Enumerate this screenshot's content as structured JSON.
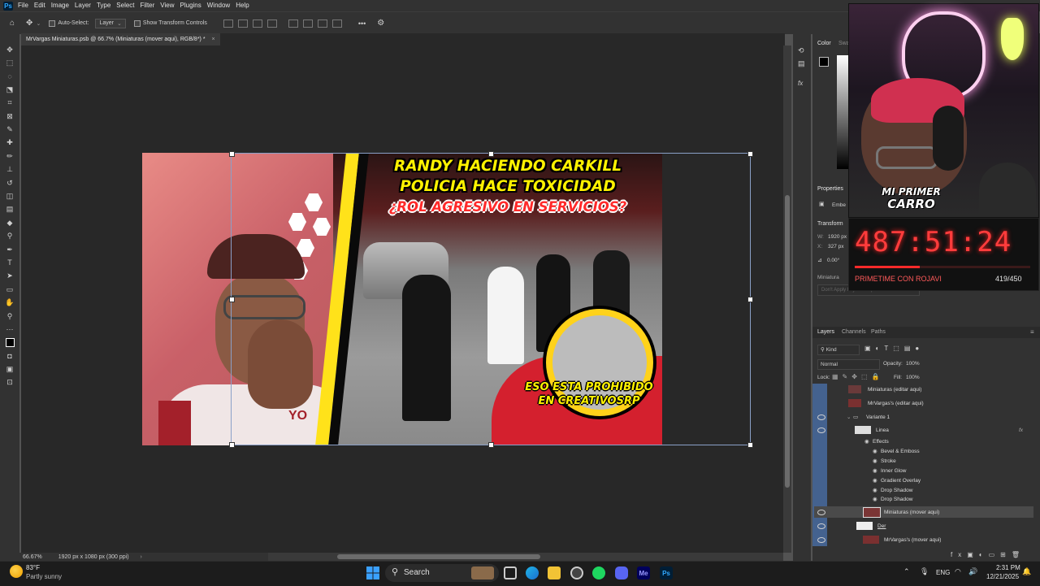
{
  "menubar": {
    "logo": "Ps",
    "items": [
      "File",
      "Edit",
      "Image",
      "Layer",
      "Type",
      "Select",
      "Filter",
      "View",
      "Plugins",
      "Window",
      "Help"
    ]
  },
  "options": {
    "auto_select_label": "Auto-Select:",
    "auto_select_value": "Layer",
    "show_transform_label": "Show Transform Controls",
    "more": "•••"
  },
  "document": {
    "tab_title": "MrVargas Miniaturas.psb @ 66.7% (Miniaturas (mover aqui), RGB/8*) *",
    "zoom": "66.67%",
    "size_info": "1920 px x 1080 px (300 ppi)"
  },
  "thumbnail": {
    "headline1": "RANDY HACIENDO CARKILL",
    "headline2": "POLICIA HACE TOXICIDAD",
    "headline3": "¿ROL AGRESIVO EN SERVICIOS?",
    "caption1": "ESO ESTA PROHIBIDO",
    "caption2": "EN CREATIVOSRP",
    "shirt_text": "YO"
  },
  "right_panel": {
    "color_tab": "Color",
    "swatches_tab": "Swa",
    "properties_title": "Properties",
    "embed_label": "Embe",
    "transform_label": "Transform",
    "w_label": "W:",
    "w_value": "1920 px",
    "x_label": "X:",
    "x_value": "327 px",
    "angle_value": "0.00°",
    "miniaturas_label": "Miniatura",
    "dont_apply": "Don't Apply Layer Comp"
  },
  "layers_panel": {
    "tabs": [
      "Layers",
      "Channels",
      "Paths"
    ],
    "kind_label": "Kind",
    "blend_mode": "Normal",
    "opacity_label": "Opacity:",
    "opacity_value": "100%",
    "lock_label": "Lock:",
    "fill_label": "Fill:",
    "fill_value": "100%",
    "rows": [
      {
        "name": "Miniaturas (editar aqui)"
      },
      {
        "name": "MrVargas's (editar aqui)"
      },
      {
        "name": "Variante 1"
      },
      {
        "name": "Linea"
      },
      {
        "name": "Effects"
      },
      {
        "name": "Bevel & Emboss"
      },
      {
        "name": "Stroke"
      },
      {
        "name": "Inner Glow"
      },
      {
        "name": "Gradient Overlay"
      },
      {
        "name": "Drop Shadow"
      },
      {
        "name": "Drop Shadow"
      },
      {
        "name": "Miniaturas (mover aqui)"
      },
      {
        "name": "Der"
      },
      {
        "name": "MrVargas's (mover aqui)"
      }
    ],
    "fx": "fx"
  },
  "stream_overlay": {
    "logo_line1": "MI PRIMER",
    "logo_line2": "CARRO",
    "timer": "487:51:24",
    "label": "PRIMETIME CON ROJAVI",
    "count": "419/450",
    "progress": 0.37
  },
  "taskbar": {
    "weather_temp": "83°F",
    "weather_desc": "Partly sunny",
    "search_label": "Search",
    "lang": "ENG",
    "time": "2:31 PM",
    "date": "12/21/2025"
  },
  "colors": {
    "accent_red": "#ff3c3c",
    "highlight_yellow": "#fff200",
    "ps_blue": "#31a8ff"
  }
}
